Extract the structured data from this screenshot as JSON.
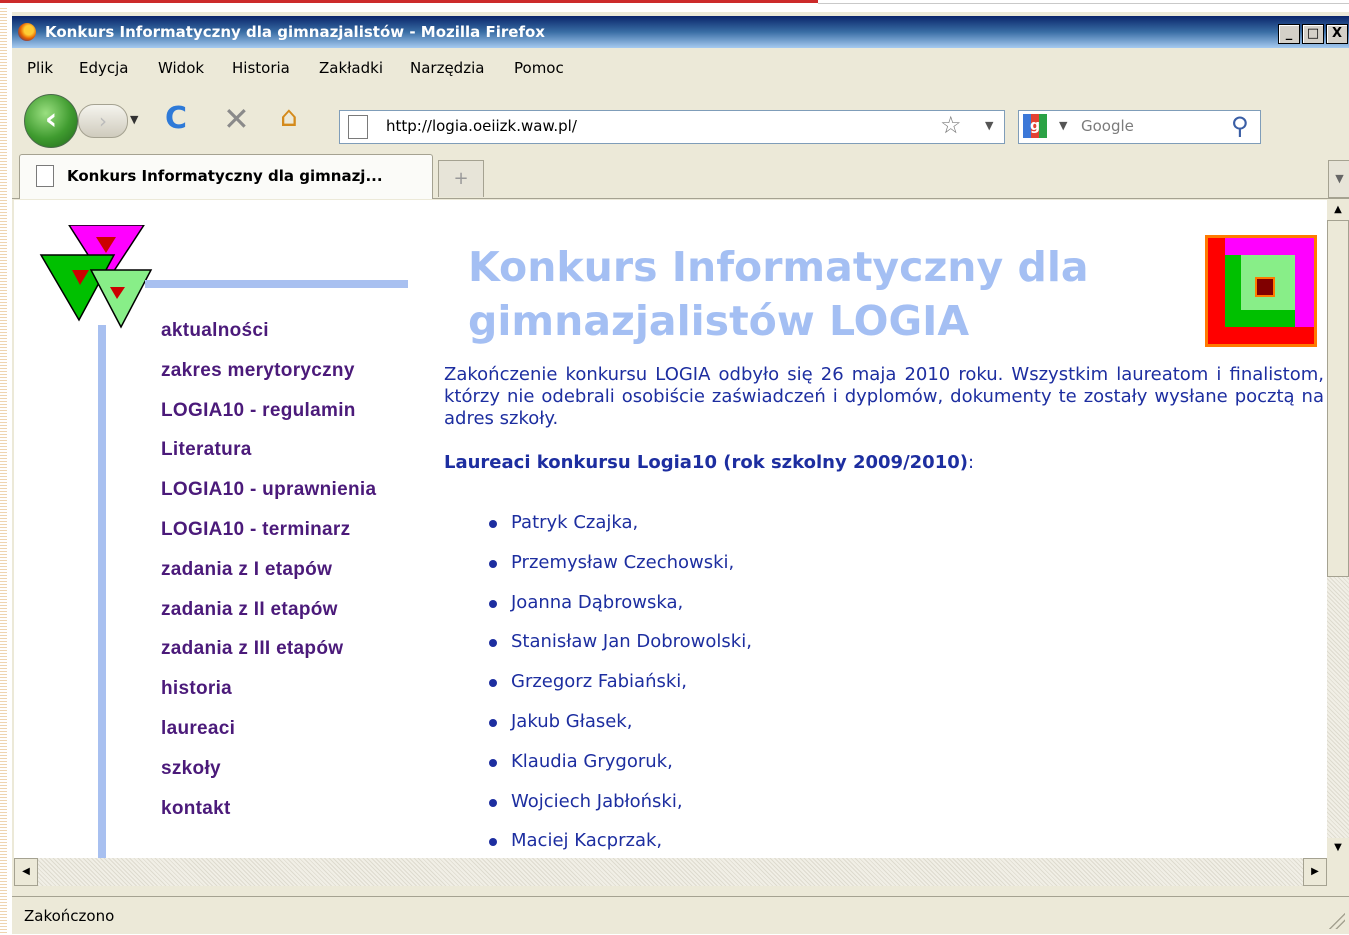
{
  "window": {
    "title": "Konkurs Informatyczny dla gimnazjalistów - Mozilla Firefox",
    "minimize": "_",
    "maximize": "□",
    "close": "X"
  },
  "menu": [
    "Plik",
    "Edycja",
    "Widok",
    "Historia",
    "Zakładki",
    "Narzędzia",
    "Pomoc"
  ],
  "navbar": {
    "url": "http://logia.oeiizk.waw.pl/",
    "search_placeholder": "Google"
  },
  "tabs": [
    {
      "label": "Konkurs Informatyczny dla gimnazj..."
    }
  ],
  "page": {
    "heading_line1": "Konkurs Informatyczny dla",
    "heading_line2": "gimnazjalistów LOGIA",
    "nav": [
      "aktualności",
      "zakres merytoryczny",
      "LOGIA10 - regulamin",
      "Literatura",
      "LOGIA10 - uprawnienia",
      "LOGIA10 - terminarz",
      "zadania z I etapów",
      "zadania z II etapów",
      "zadania z III etapów",
      "historia",
      "laureaci",
      "szkoły",
      "kontakt"
    ],
    "intro": "Zakończenie konkursu LOGIA odbyło się 26 maja 2010 roku. Wszystkim laureatom i finalistom, którzy nie odebrali osobiście zaświadczeń i dyplomów, dokumenty te zostały wysłane pocztą na adres szkoły.",
    "laureates_heading": "Laureaci konkursu Logia10 (rok szkolny 2009/2010)",
    "laureates_heading_suffix": ":",
    "laureates": [
      "Patryk Czajka,",
      "Przemysław Czechowski,",
      "Joanna Dąbrowska,",
      "Stanisław Jan Dobrowolski,",
      "Grzegorz Fabiański,",
      "Jakub Głasek,",
      "Klaudia Grygoruk,",
      "Wojciech Jabłoński,",
      "Maciej Kacprzak,"
    ]
  },
  "status": "Zakończono",
  "colors": {
    "nav_link": "#4b1a7a",
    "heading": "#a4bff3",
    "body_text": "#1d2ea0",
    "accent_bar": "#a8c0f0"
  }
}
